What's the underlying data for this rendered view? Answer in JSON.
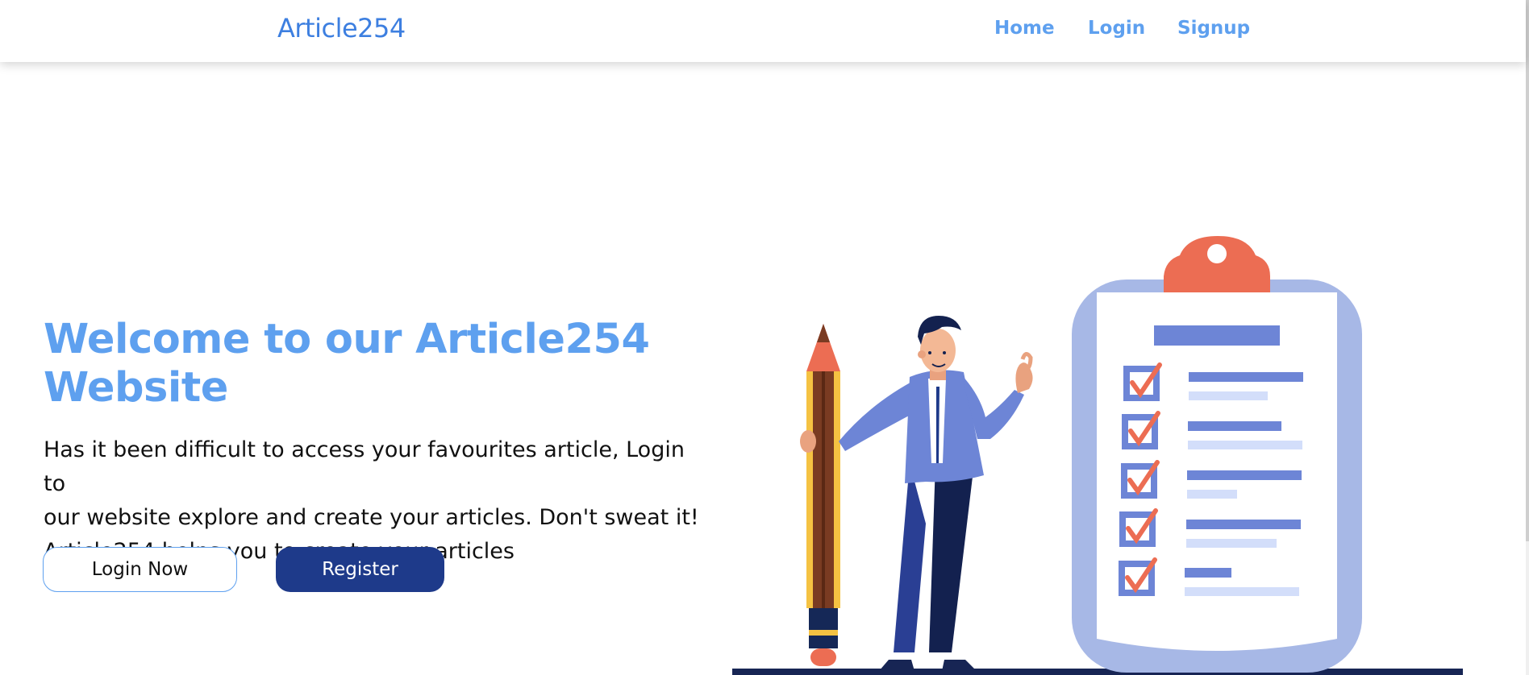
{
  "nav": {
    "brand": "Article254",
    "links": [
      "Home",
      "Login",
      "Signup"
    ]
  },
  "hero": {
    "title_line1": "Welcome to our Article254",
    "title_line2": "Website",
    "desc_line1": "Has it been difficult to access your favourites article, Login to",
    "desc_line2": "our website explore and create your articles. Don't sweat it!",
    "desc_line3": "Article254 helps you to create your articles",
    "login_button": "Login Now",
    "register_button": "Register"
  },
  "colors": {
    "brand": "#3d7fe0",
    "nav_link": "#5ea0ef",
    "heading": "#5ea0ef",
    "register_bg": "#1e3a8a",
    "clipboard_clip": "#ec6d53",
    "clipboard_board": "#a7b8e6",
    "check_box": "#6d85d6"
  },
  "illustration": {
    "icons": [
      "pencil-icon",
      "person-figure",
      "clipboard-icon",
      "checkbox-icon"
    ]
  }
}
